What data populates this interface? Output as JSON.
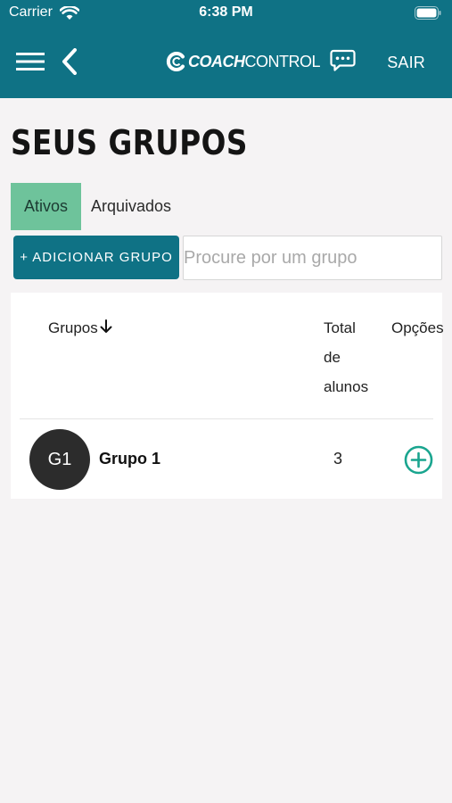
{
  "status_bar": {
    "carrier": "Carrier",
    "time": "6:38 PM"
  },
  "navbar": {
    "menu_icon": "hamburger-menu-icon",
    "back_icon": "chevron-left-icon",
    "brand_bold": "COACH",
    "brand_light": "CONTROL",
    "chat_icon": "chat-bubble-icon",
    "logout_label": "SAIR",
    "color": "#0f7285"
  },
  "page": {
    "title": "SEUS GRUPOS"
  },
  "tabs": [
    {
      "label": "Ativos",
      "active": true
    },
    {
      "label": "Arquivados",
      "active": false
    }
  ],
  "actions": {
    "add_group_label": "+ ADICIONAR GRUPO",
    "search_placeholder": "Procure por um grupo",
    "search_value": ""
  },
  "table": {
    "columns": {
      "groups": "Grupos",
      "total_line1": "Total",
      "total_line2": "de",
      "total_line3": "alunos",
      "options": "Opções"
    },
    "sort_icon": "arrow-down-icon",
    "rows": [
      {
        "avatar": "G1",
        "name": "Grupo 1",
        "total": "3",
        "option_icon": "plus-circle-icon"
      }
    ]
  },
  "colors": {
    "accent": "#0f7285",
    "active_tab": "#6ec39b",
    "add_icon": "#1aa58f",
    "background": "#f5f3f4"
  }
}
